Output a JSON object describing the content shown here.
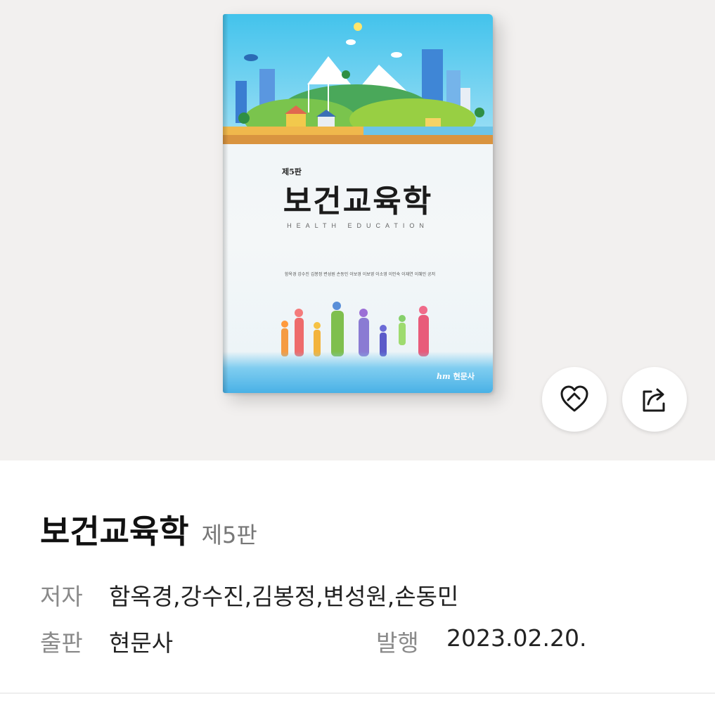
{
  "cover": {
    "edition": "제5판",
    "title": "보건교육학",
    "subtitle": "HEALTH EDUCATION",
    "authors": "함옥경 강수진 김봉정 변성원 손동민 이보경 이보영 이소영 이인숙 이재연 이혜민 공저",
    "publisher_logo": "hm",
    "publisher": "현문사"
  },
  "actions": {
    "like_icon": "heart-icon",
    "share_icon": "share-icon"
  },
  "book": {
    "title": "보건교육학",
    "edition": "제5판",
    "author_label": "저자",
    "authors": "함옥경,강수진,김봉정,변성원,손동민",
    "publisher_label": "출판",
    "publisher": "현문사",
    "published_label": "발행",
    "published_date": "2023.02.20."
  },
  "colors": {
    "hero_bg": "#f2f0ef",
    "title_text": "#111111",
    "label_text": "#8a8a8a"
  }
}
